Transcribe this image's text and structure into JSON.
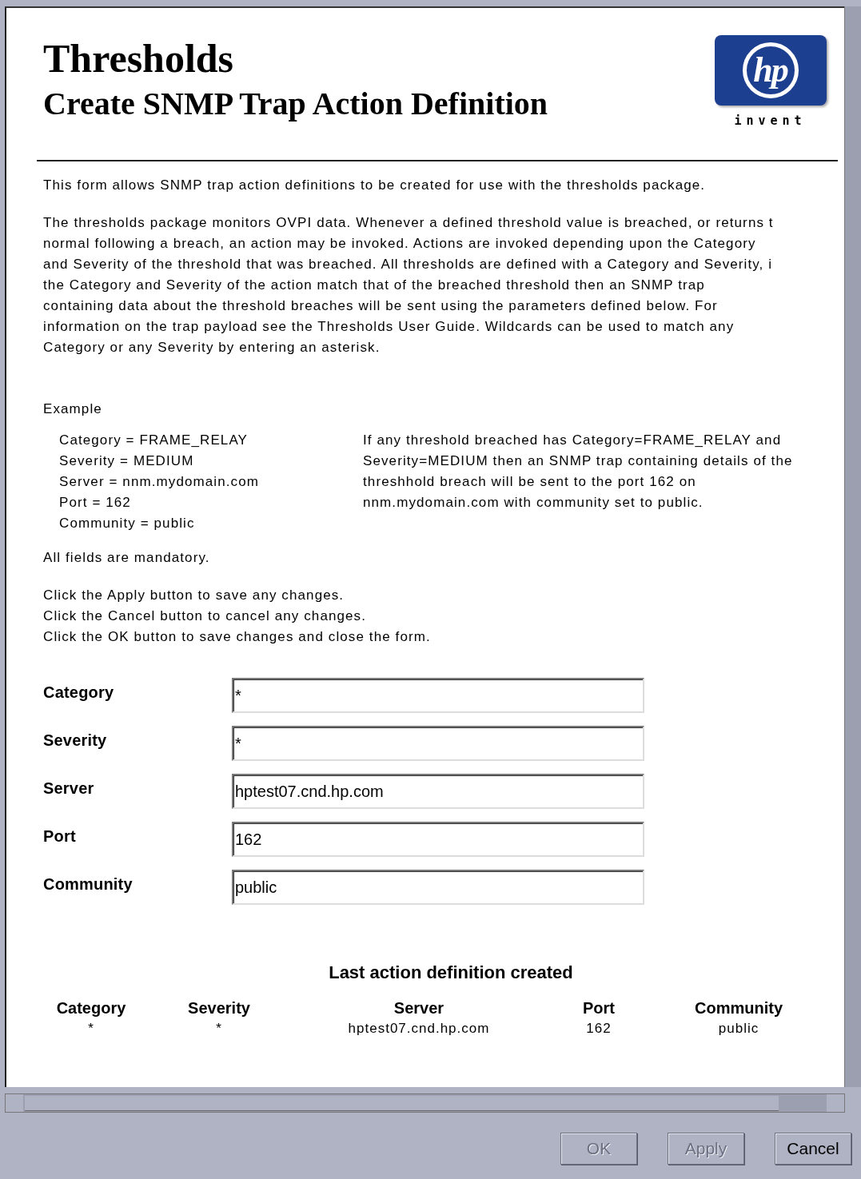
{
  "header": {
    "title": "Thresholds",
    "subtitle": "Create SNMP Trap Action Definition",
    "logo": {
      "mark": "hp",
      "tagline": "invent"
    }
  },
  "intro": "This form allows SNMP trap action definitions to be created for use with the thresholds package.",
  "description_lines": [
    "The thresholds package monitors OVPI data.  Whenever a defined threshold value is breached, or returns t",
    "normal following a breach, an action may be invoked.  Actions are invoked depending upon the Category",
    "and Severity of the threshold that was breached.  All thresholds are defined with a Category and Severity, i",
    "the Category and Severity of the action match that of the breached threshold then an SNMP trap",
    "containing data about the threshold breaches will be sent using the parameters defined below.  For",
    "information on the trap payload see the Thresholds User Guide.  Wildcards can be used to match any",
    "Category or any Severity by entering an asterisk."
  ],
  "example": {
    "heading": "Example",
    "settings": [
      "Category = FRAME_RELAY",
      "Severity = MEDIUM",
      "Server = nnm.mydomain.com",
      "Port = 162",
      "Community = public"
    ],
    "explanation_lines": [
      "If any threshold breached has Category=FRAME_RELAY and",
      "Severity=MEDIUM then an SNMP trap containing details of the",
      "threshhold breach will be sent to the port 162 on",
      "nnm.mydomain.com with community set to public."
    ]
  },
  "mandatory_note": "All fields are mandatory.",
  "instructions": [
    "Click the Apply button to save any changes.",
    "Click the Cancel button to cancel any changes.",
    "Click the OK button to save changes and close the form."
  ],
  "fields": [
    {
      "label": "Category",
      "value": "*"
    },
    {
      "label": "Severity",
      "value": "*"
    },
    {
      "label": "Server",
      "value": "hptest07.cnd.hp.com"
    },
    {
      "label": "Port",
      "value": "162"
    },
    {
      "label": "Community",
      "value": "public"
    }
  ],
  "last_created": {
    "title": "Last action definition created",
    "columns": [
      "Category",
      "Severity",
      "Server",
      "Port",
      "Community"
    ],
    "row": [
      "*",
      "*",
      "hptest07.cnd.hp.com",
      "162",
      "public"
    ]
  },
  "buttons": [
    {
      "label": "OK",
      "disabled": true
    },
    {
      "label": "Apply",
      "disabled": true
    },
    {
      "label": "Cancel",
      "disabled": false
    }
  ]
}
